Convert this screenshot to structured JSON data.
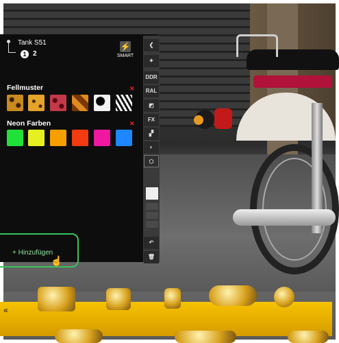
{
  "part_header": {
    "name": "Tank S51",
    "levels": [
      "1",
      "2"
    ],
    "smart_label": "SMART"
  },
  "sections": [
    {
      "title": "Fellmuster",
      "swatch_count": 6
    },
    {
      "title": "Neon Farben",
      "colors": [
        "#22e03a",
        "#e6f020",
        "#f5a000",
        "#f43a10",
        "#f018a0",
        "#1e86ff"
      ]
    }
  ],
  "toolbar": {
    "ddr_label": "DDR",
    "ral_label": "RAL",
    "fx_label": "FX"
  },
  "add_button": {
    "label": "+ Hinzufügen"
  },
  "parts_bar": {
    "back_label": "«"
  }
}
